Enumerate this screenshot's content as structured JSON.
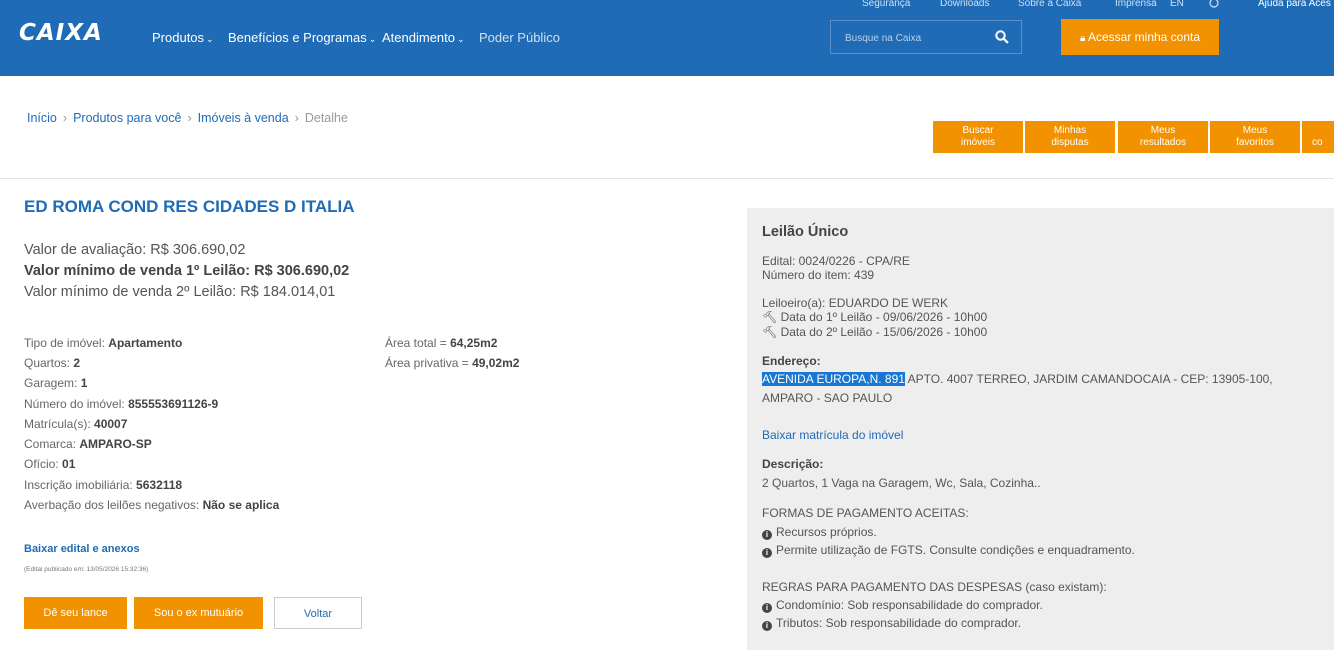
{
  "header": {
    "logo": "CAIXA",
    "nav": [
      "Produtos",
      "Benefícios e Programas",
      "Atendimento",
      "Poder Público"
    ],
    "top_links": [
      "Segurança",
      "Downloads",
      "Sobre a Caixa",
      "Imprensa",
      "EN",
      "Ajuda para Aces"
    ],
    "search_placeholder": "Busque na Caixa",
    "login_label": "Acessar minha conta"
  },
  "breadcrumb": [
    "Início",
    "Produtos para você",
    "Imóveis à venda",
    "Detalhe"
  ],
  "quick_buttons": [
    [
      "Buscar",
      "imóveis"
    ],
    [
      "Minhas",
      "disputas"
    ],
    [
      "Meus",
      "resultados"
    ],
    [
      "Meus",
      "favoritos"
    ],
    [
      "",
      "co"
    ]
  ],
  "property": {
    "title": "ED ROMA COND RES CIDADES D ITALIA",
    "valor_avaliacao": "Valor de avaliação: R$ 306.690,02",
    "valor_1": "Valor mínimo de venda 1º Leilão: R$ 306.690,02",
    "valor_2": "Valor mínimo de venda 2º Leilão: R$ 184.014,01",
    "details": [
      {
        "label": "Tipo de imóvel:",
        "value": "Apartamento"
      },
      {
        "label": "Quartos:",
        "value": "2"
      },
      {
        "label": "Garagem:",
        "value": "1"
      },
      {
        "label": "Número do imóvel:",
        "value": "855553691126-9"
      },
      {
        "label": "Matrícula(s):",
        "value": "40007"
      },
      {
        "label": "Comarca:",
        "value": "AMPARO-SP"
      },
      {
        "label": "Ofício:",
        "value": "01"
      },
      {
        "label": "Inscrição imobiliária:",
        "value": "5632118"
      },
      {
        "label": "Averbação dos leilões negativos:",
        "value": "Não se aplica"
      }
    ],
    "areas": [
      {
        "label": "Área total =",
        "value": "64,25m2"
      },
      {
        "label": "Área privativa =",
        "value": "49,02m2"
      }
    ],
    "edital_link": "Baixar edital e anexos",
    "edital_published": "(Edital publicado em: 13/05/2026 15:32:36)",
    "buttons": {
      "lance": "Dê seu lance",
      "mutuario": "Sou o ex mutuário",
      "voltar": "Voltar"
    }
  },
  "auction": {
    "title": "Leilão Único",
    "edital": "Edital: 0024/0226 - CPA/RE",
    "item": "Número do item: 439",
    "leiloeiro": "Leiloeiro(a): EDUARDO DE WERK",
    "data1": "Data do 1º Leilão - 09/06/2026 - 10h00",
    "data2": "Data do 2º Leilão - 15/06/2026 - 10h00",
    "endereco_label": "Endereço:",
    "endereco_highlight": "AVENIDA EUROPA,N. 891",
    "endereco_rest": " APTO. 4007 TERREO, JARDIM CAMANDOCAIA - CEP: 13905-100,",
    "endereco_line2": "AMPARO - SAO PAULO",
    "matricula_link": "Baixar matrícula do imóvel",
    "descricao_label": "Descrição:",
    "descricao": "2 Quartos, 1 Vaga na Garagem, Wc, Sala, Cozinha..",
    "formas_title": "FORMAS DE PAGAMENTO ACEITAS:",
    "formas": [
      "Recursos próprios.",
      "Permite utilização de FGTS. Consulte condições e enquadramento."
    ],
    "regras_title": "REGRAS PARA PAGAMENTO DAS DESPESAS (caso existam):",
    "regras": [
      "Condomínio: Sob responsabilidade do comprador.",
      "Tributos: Sob responsabilidade do comprador."
    ]
  },
  "colors": {
    "primary": "#1f6bb6",
    "accent": "#f39200",
    "panel": "#eeeeee"
  }
}
